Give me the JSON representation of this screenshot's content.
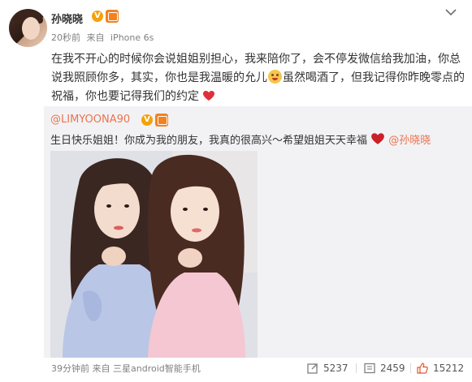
{
  "post": {
    "author": "孙晓晓",
    "time": "20秒前",
    "source_prefix": "来自",
    "source": "iPhone 6s",
    "text_part1": "在我不开心的时候你会说姐姐别担心，我来陪你了，会不停发微信给我加油，你总说我照顾你多，其实，你也是我温暖的允儿",
    "text_part2": "虽然喝酒了，但我记得你昨晚零点的祝福，你也要记得我们的约定"
  },
  "repost": {
    "author": "@LIMYOONA90",
    "text": "生日快乐姐姐！你成为我的朋友，我真的很高兴～希望姐姐天天幸福",
    "mention": "@孙晓晓"
  },
  "footer": {
    "time": "39分钟前",
    "source_prefix": "来自",
    "source": "三星android智能手机",
    "reposts": "5237",
    "comments": "2459",
    "likes": "15212"
  },
  "colors": {
    "link": "#eb7350",
    "verified_badge": "#f3a20a",
    "member_badge": "#f2821f",
    "heart": "#e0303a"
  },
  "icons": [
    "chevron-down-icon",
    "verified-icon",
    "member-icon",
    "emoji-icon",
    "heart-icon",
    "repost-icon",
    "comment-icon",
    "like-icon"
  ]
}
